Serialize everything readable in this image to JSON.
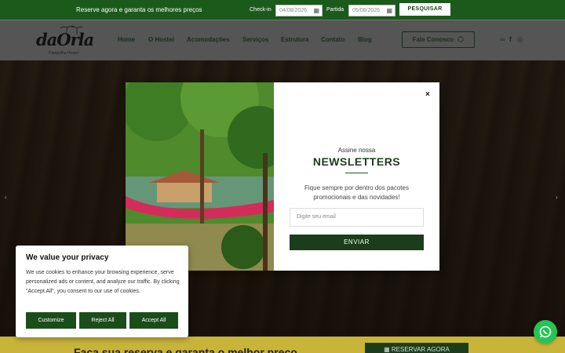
{
  "topbar": {
    "promo": "Reserve agora e garanta os melhores preços",
    "checkin_label": "Check-in",
    "checkin_value": "04/08/2026",
    "partida_label": "Partida",
    "partida_value": "05/08/2026",
    "search_label": "PESQUISAR",
    "calendar_icon": "calendar-icon"
  },
  "nav": {
    "logo_text": "daOrla",
    "logo_sub": "Pampulha Hostel",
    "items": [
      {
        "label": "Home"
      },
      {
        "label": "O Hostel"
      },
      {
        "label": "Acomodações"
      },
      {
        "label": "Serviços"
      },
      {
        "label": "Estrutura"
      },
      {
        "label": "Contato"
      },
      {
        "label": "Blog"
      }
    ],
    "cta_label": "Fale Conosco",
    "social_icons": [
      "tripadvisor-icon",
      "facebook-icon",
      "instagram-icon"
    ]
  },
  "modal": {
    "kicker": "Assine nossa",
    "title": "NEWSLETTERS",
    "description": "Fique sempre por dentro dos pacotes promocionais e das novidades!",
    "email_placeholder": "Digite seu email",
    "submit_label": "ENVIAR",
    "close_glyph": "×"
  },
  "cookie": {
    "title": "We value your privacy",
    "text": "We use cookies to enhance your browsing experience, serve personalized ads or content, and analyze our traffic. By clicking \"Accept All\", you consent to our use of cookies.",
    "customize_label": "Customize",
    "reject_label": "Reject All",
    "accept_label": "Accept All"
  },
  "bottombar": {
    "text": "Faça sua reserva e garanta o melhor preço",
    "reserve_label": "RESERVAR AGORA"
  },
  "hero": {
    "prev_glyph": "‹",
    "next_glyph": "›"
  },
  "colors": {
    "brand_green": "#1b3d1b",
    "topbar_green": "#1b5a1b",
    "accent_yellow": "#c9b43a",
    "whatsapp": "#25c455"
  }
}
